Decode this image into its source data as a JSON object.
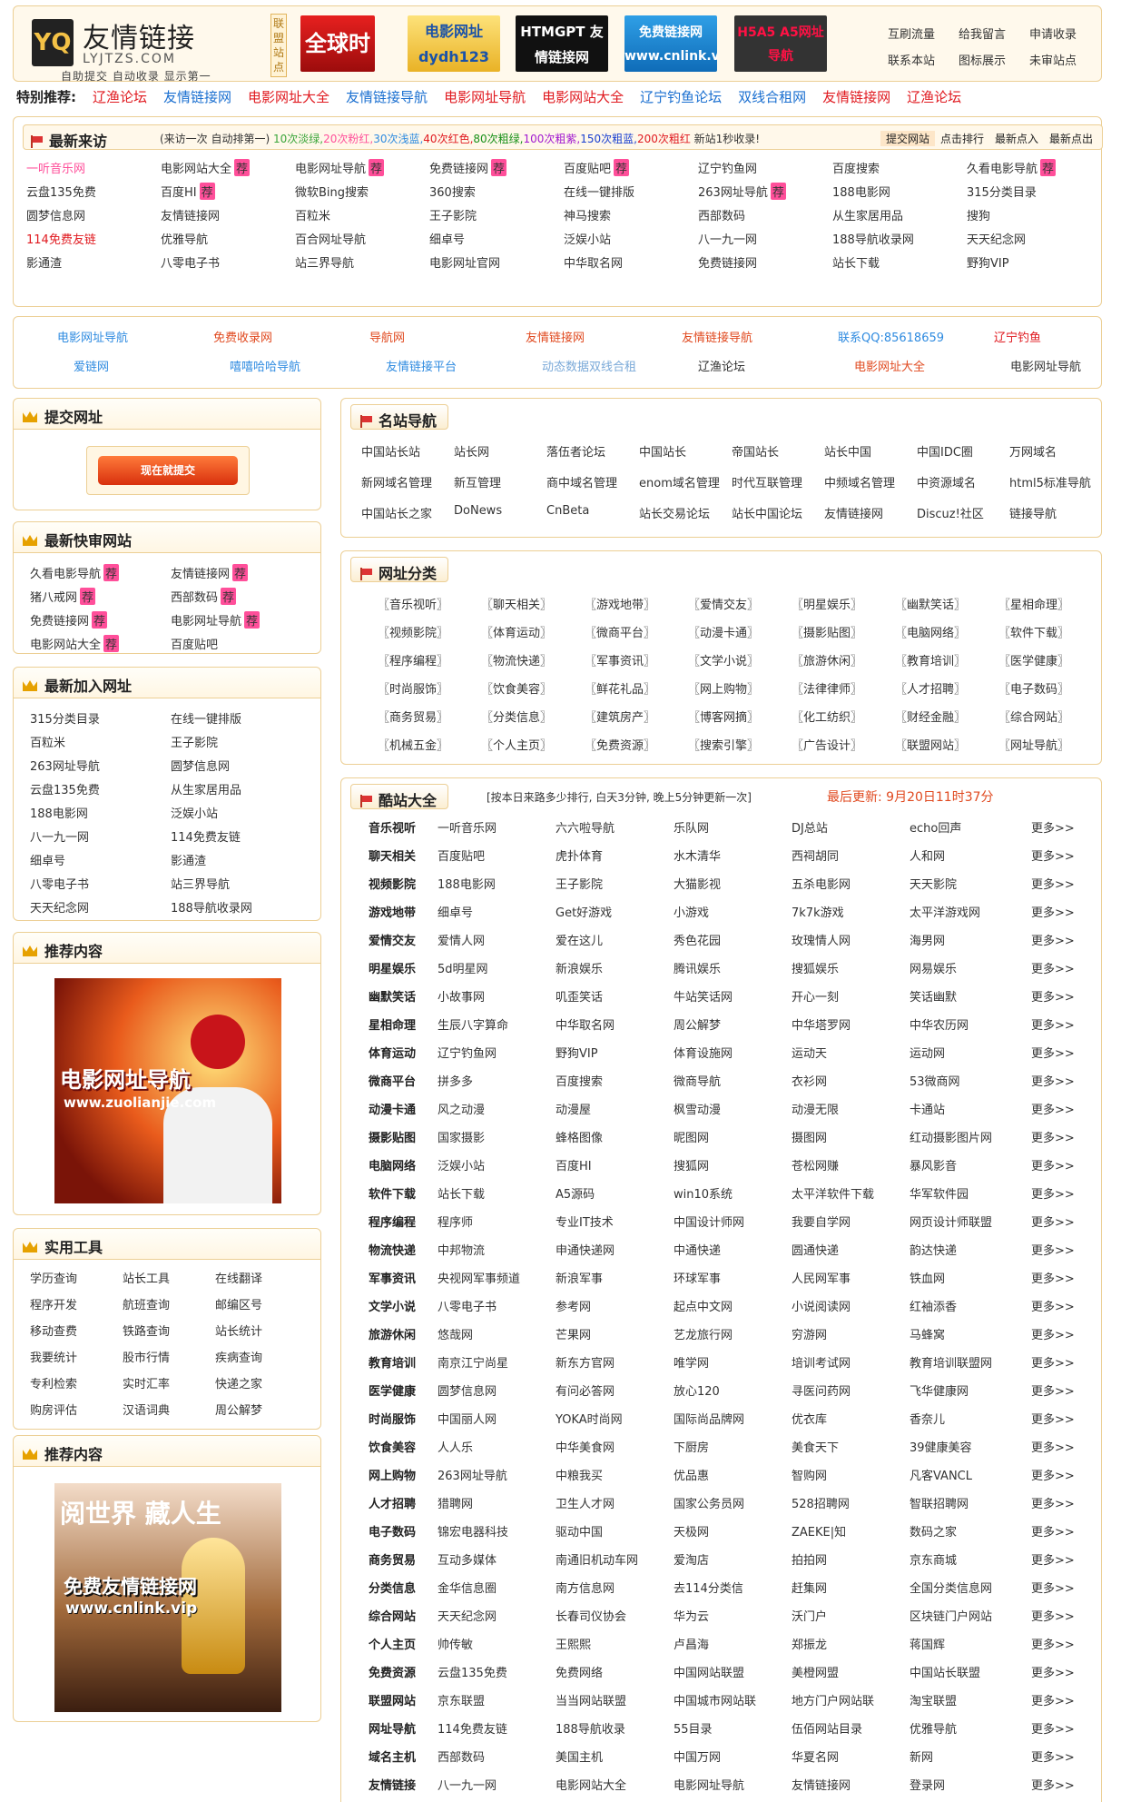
{
  "header": {
    "logo_mark": "YQ",
    "logo_cn": "友情链接",
    "logo_en": "LYJTZS.COM",
    "logo_sub": "自助提交  自动收录  显示第一",
    "lianmeng": "联盟站点",
    "banners": [
      "全球时刻",
      "电影网址 dydh123",
      "HTMGPT 友情链接网",
      "免费链接网 www.cnlink.vip",
      "H5A5 A5网址导航"
    ],
    "links": [
      "互刷流量",
      "给我留言",
      "申请收录",
      "联系本站",
      "图标展示",
      "未审站点"
    ]
  },
  "special": {
    "label": "特别推荐:",
    "items": [
      {
        "t": "辽渔论坛",
        "c": "#e0191f"
      },
      {
        "t": "友情链接网",
        "c": "#1a6fd0"
      },
      {
        "t": "电影网址大全",
        "c": "#e0191f"
      },
      {
        "t": "友情链接导航",
        "c": "#1a6fd0"
      },
      {
        "t": "电影网址导航",
        "c": "#e0191f"
      },
      {
        "t": "电影网站大全",
        "c": "#e0191f"
      },
      {
        "t": "辽宁钓鱼论坛",
        "c": "#1a6fd0"
      },
      {
        "t": "双线合租网",
        "c": "#1a6fd0"
      },
      {
        "t": "友情链接网",
        "c": "#e0191f"
      },
      {
        "t": "辽渔论坛",
        "c": "#e0191f"
      }
    ]
  },
  "newest": {
    "title": "最新来访",
    "note_prefix": "(来访一次 自动排第一)",
    "note_parts": [
      {
        "t": "10次淡绿,",
        "c": "#3aa53a"
      },
      {
        "t": "20次粉红,",
        "c": "#ff4f9a"
      },
      {
        "t": "30次浅蓝,",
        "c": "#2f8be0"
      },
      {
        "t": "40次红色,",
        "c": "#e0191f"
      },
      {
        "t": "80次粗绿,",
        "c": "#189018"
      },
      {
        "t": "100次粗紫,",
        "c": "#a21ad0"
      },
      {
        "t": "150次粗蓝,",
        "c": "#1a3fd0"
      },
      {
        "t": "200次粗红",
        "c": "#e0191f"
      },
      {
        "t": " 新站1秒收录!",
        "c": "#333"
      }
    ],
    "tabs": [
      "提交网站",
      "点击排行",
      "最新点入",
      "最新点出"
    ],
    "rows": [
      [
        "一听音乐网",
        "电影网站大全",
        "电影网址导航",
        "免费链接网",
        "百度贴吧",
        "辽宁钓鱼网",
        "百度搜索",
        "久看电影导航"
      ],
      [
        "云盘135免费",
        "百度HI",
        "微软Bing搜索",
        "360搜索",
        "在线一键排版",
        "263网址导航",
        "188电影网",
        "315分类目录"
      ],
      [
        "圆梦信息网",
        "友情链接网",
        "百粒米",
        "王子影院",
        "神马搜索",
        "西部数码",
        "从生家居用品",
        "搜狗"
      ],
      [
        "114免费友链",
        "优雅导航",
        "百合网址导航",
        "细卓号",
        "泛娱小站",
        "八一九一网",
        "188导航收录网",
        "天天纪念网"
      ],
      [
        "影通渣",
        "八零电子书",
        "站三界导航",
        "电影网址官网",
        "中华取名网",
        "免费链接网",
        "站长下载",
        "野狗VIP"
      ]
    ]
  },
  "promo": {
    "row1": [
      {
        "t": "电影网址导航",
        "c": "#2f8be0"
      },
      {
        "t": "免费收录网",
        "c": "#e0491f"
      },
      {
        "t": "导航网",
        "c": "#e0491f"
      },
      {
        "t": "友情链接网",
        "c": "#e0491f"
      },
      {
        "t": "友情链接导航",
        "c": "#e0491f"
      },
      {
        "t": "联系QQ:85618659",
        "c": "#2f8be0"
      },
      {
        "t": "辽宁钓鱼",
        "c": "#e0191f"
      }
    ],
    "row2": [
      {
        "t": "爱链网",
        "c": "#2f8be0"
      },
      {
        "t": "嘻嘻哈哈导航",
        "c": "#2f8be0"
      },
      {
        "t": "友情链接平台",
        "c": "#2f8be0"
      },
      {
        "t": "动态数据双线合租",
        "c": "#7aa9d8"
      },
      {
        "t": "辽渔论坛",
        "c": "#333"
      },
      {
        "t": "电影网址大全",
        "c": "#e0491f"
      },
      {
        "t": "电影网址导航",
        "c": "#333"
      }
    ]
  },
  "submit": {
    "title": "提交网址",
    "button": "现在就提交"
  },
  "fastest": {
    "title": "最新快审网站",
    "items": [
      "久看电影导航",
      "友情链接网",
      "猪八戒网",
      "西部数码",
      "免费链接网",
      "电影网址导航",
      "电影网站大全",
      "百度贴吧"
    ]
  },
  "recent": {
    "title": "最新加入网址",
    "items": [
      "315分类目录",
      "在线一键排版",
      "百粒米",
      "王子影院",
      "263网址导航",
      "圆梦信息网",
      "云盘135免费",
      "从生家居用品",
      "188电影网",
      "泛娱小站",
      "八一九一网",
      "114免费友链",
      "细卓号",
      "影通渣",
      "八零电子书",
      "站三界导航",
      "天天纪念网",
      "188导航收录网"
    ]
  },
  "rec1": {
    "title": "推荐内容",
    "img_text": "电影网址导航",
    "img_url": "www.zuolianjie.com"
  },
  "tools": {
    "title": "实用工具",
    "items": [
      "学历查询",
      "站长工具",
      "在线翻译",
      "程序开发",
      "航班查询",
      "邮编区号",
      "移动查费",
      "铁路查询",
      "站长统计",
      "我要统计",
      "股市行情",
      "疾病查询",
      "专利检索",
      "实时汇率",
      "快递之家",
      "购房评估",
      "汉语词典",
      "周公解梦"
    ]
  },
  "rec2": {
    "title": "推荐内容",
    "img_top": "阅世界 藏人生",
    "img_text": "免费友情链接网",
    "img_url": "www.cnlink.vip"
  },
  "famous": {
    "title": "名站导航",
    "rows": [
      [
        "中国站长站",
        "站长网",
        "落伍者论坛",
        "中国站长",
        "帝国站长",
        "站长中国",
        "中国IDC圈",
        "万网域名"
      ],
      [
        "新网域名管理",
        "新互管理",
        "商中域名管理",
        "enom域名管理",
        "时代互联管理",
        "中频域名管理",
        "中资源域名",
        "html5标准导航"
      ],
      [
        "中国站长之家",
        "DoNews",
        "CnBeta",
        "站长交易论坛",
        "站长中国论坛",
        "友情链接网",
        "Discuz!社区",
        "链接导航"
      ]
    ]
  },
  "category": {
    "title": "网址分类",
    "items": [
      "〖音乐视听〗",
      "〖聊天相关〗",
      "〖游戏地带〗",
      "〖爱情交友〗",
      "〖明星娱乐〗",
      "〖幽默笑话〗",
      "〖星相命理〗",
      "〖视频影院〗",
      "〖体育运动〗",
      "〖微商平台〗",
      "〖动漫卡通〗",
      "〖摄影贴图〗",
      "〖电脑网络〗",
      "〖软件下载〗",
      "〖程序编程〗",
      "〖物流快递〗",
      "〖军事资讯〗",
      "〖文学小说〗",
      "〖旅游休闲〗",
      "〖教育培训〗",
      "〖医学健康〗",
      "〖时尚服饰〗",
      "〖饮食美容〗",
      "〖鲜花礼品〗",
      "〖网上购物〗",
      "〖法律律师〗",
      "〖人才招聘〗",
      "〖电子数码〗",
      "〖商务贸易〗",
      "〖分类信息〗",
      "〖建筑房产〗",
      "〖博客网摘〗",
      "〖化工纺织〗",
      "〖财经金融〗",
      "〖综合网站〗",
      "〖机械五金〗",
      "〖个人主页〗",
      "〖免费资源〗",
      "〖搜索引擎〗",
      "〖广告设计〗",
      "〖联盟网站〗",
      "〖网址导航〗"
    ]
  },
  "cool": {
    "title": "酷站大全",
    "note": "[按本日来路多少排行, 白天3分钟, 晚上5分钟更新一次]",
    "updated": "最后更新: 9月20日11时37分",
    "more": "更多>>",
    "rows": [
      [
        "音乐视听",
        "一听音乐网",
        "六六啦导航",
        "乐队网",
        "DJ总站",
        "echo回声"
      ],
      [
        "聊天相关",
        "百度贴吧",
        "虎扑体育",
        "水木清华",
        "西祠胡同",
        "人和网"
      ],
      [
        "视频影院",
        "188电影网",
        "王子影院",
        "大猫影视",
        "五杀电影网",
        "天天影院"
      ],
      [
        "游戏地带",
        "细卓号",
        "Get好游戏",
        "小游戏",
        "7k7k游戏",
        "太平洋游戏网"
      ],
      [
        "爱情交友",
        "爱情人网",
        "爱在这儿",
        "秀色花园",
        "玫瑰情人网",
        "海男网"
      ],
      [
        "明星娱乐",
        "5d明星网",
        "新浪娱乐",
        "腾讯娱乐",
        "搜狐娱乐",
        "网易娱乐"
      ],
      [
        "幽默笑话",
        "小故事网",
        "叽歪笑话",
        "牛站笑话网",
        "开心一刻",
        "笑话幽默"
      ],
      [
        "星相命理",
        "生辰八字算命",
        "中华取名网",
        "周公解梦",
        "中华塔罗网",
        "中华农历网"
      ],
      [
        "体育运动",
        "辽宁钓鱼网",
        "野狗VIP",
        "体育设施网",
        "运动天",
        "运动网"
      ],
      [
        "微商平台",
        "拼多多",
        "百度搜索",
        "微商导航",
        "衣衫网",
        "53微商网"
      ],
      [
        "动漫卡通",
        "风之动漫",
        "动漫屋",
        "枫雪动漫",
        "动漫无限",
        "卡通站"
      ],
      [
        "摄影贴图",
        "国家摄影",
        "蜂格图像",
        "昵图网",
        "摄图网",
        "红动摄影图片网"
      ],
      [
        "电脑网络",
        "泛娱小站",
        "百度HI",
        "搜狐网",
        "苍松网赚",
        "暴风影音"
      ],
      [
        "软件下载",
        "站长下载",
        "A5源码",
        "win10系统",
        "太平洋软件下载",
        "华军软件园"
      ],
      [
        "程序编程",
        "程序师",
        "专业IT技术",
        "中国设计师网",
        "我要自学网",
        "网页设计师联盟"
      ],
      [
        "物流快递",
        "中邦物流",
        "申通快递网",
        "中通快递",
        "圆通快递",
        "韵达快递"
      ],
      [
        "军事资讯",
        "央视网军事频道",
        "新浪军事",
        "环球军事",
        "人民网军事",
        "铁血网"
      ],
      [
        "文学小说",
        "八零电子书",
        "参考网",
        "起点中文网",
        "小说阅读网",
        "红袖添香"
      ],
      [
        "旅游休闲",
        "悠哉网",
        "芒果网",
        "艺龙旅行网",
        "穷游网",
        "马蜂窝"
      ],
      [
        "教育培训",
        "南京江宁尚星",
        "新东方官网",
        "唯学网",
        "培训考试网",
        "教育培训联盟网"
      ],
      [
        "医学健康",
        "圆梦信息网",
        "有问必答网",
        "放心120",
        "寻医问药网",
        "飞华健康网"
      ],
      [
        "时尚服饰",
        "中国丽人网",
        "YOKA时尚网",
        "国际尚品牌网",
        "优衣库",
        "香奈儿"
      ],
      [
        "饮食美容",
        "人人乐",
        "中华美食网",
        "下厨房",
        "美食天下",
        "39健康美容"
      ],
      [
        "网上购物",
        "263网址导航",
        "中粮我买",
        "优品惠",
        "智购网",
        "凡客VANCL"
      ],
      [
        "人才招聘",
        "猎聘网",
        "卫生人才网",
        "国家公务员网",
        "528招聘网",
        "智联招聘网"
      ],
      [
        "电子数码",
        "锦宏电器科技",
        "驱动中国",
        "天极网",
        "ZAEKE|知",
        "数码之家"
      ],
      [
        "商务贸易",
        "互动多媒体",
        "南通旧机动车网",
        "爱淘店",
        "拍拍网",
        "京东商城"
      ],
      [
        "分类信息",
        "金华信息圈",
        "南方信息网",
        "去114分类信",
        "赶集网",
        "全国分类信息网"
      ],
      [
        "综合网站",
        "天天纪念网",
        "长春司仪协会",
        "华为云",
        "沃门户",
        "区块链门户网站"
      ],
      [
        "个人主页",
        "帅传敏",
        "王熙熙",
        "卢昌海",
        "郑振龙",
        "蒋国辉"
      ],
      [
        "免费资源",
        "云盘135免费",
        "免费网络",
        "中国网站联盟",
        "美橙网盟",
        "中国站长联盟"
      ],
      [
        "联盟网站",
        "京东联盟",
        "当当网站联盟",
        "中国城市网站联",
        "地方门户网站联",
        "淘宝联盟"
      ],
      [
        "网址导航",
        "114免费友链",
        "188导航收录",
        "55目录",
        "伍佰网站目录",
        "优雅导航"
      ],
      [
        "域名主机",
        "西部数码",
        "美国主机",
        "中国万网",
        "华夏名网",
        "新网"
      ],
      [
        "友情链接",
        "八一九一网",
        "电影网站大全",
        "电影网址导航",
        "友情链接网",
        "登录网"
      ]
    ]
  }
}
